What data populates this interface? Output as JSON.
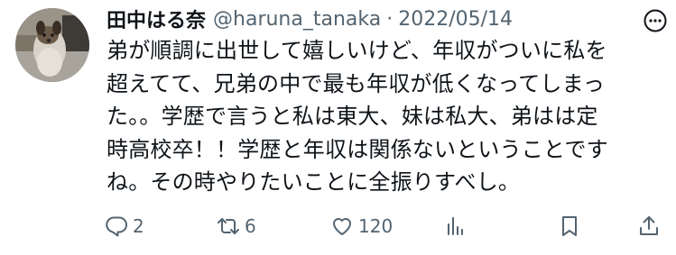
{
  "tweet": {
    "display_name": "田中はる奈",
    "handle": "@haruna_tanaka",
    "separator": "·",
    "date": "2022/05/14",
    "body_lines": [
      "弟が順調に出世して嬉しいけど、年収がついに私を",
      "超えてて、兄弟の中で最も年収が低くなってしまっ",
      "た。。学歴で言うと私は東大、妹は私大、弟はは定",
      "時高校卒！！学歴と年収は関係ないということです",
      "ね。その時やりたいことに全振りすべし。"
    ]
  },
  "actions": {
    "reply": {
      "icon": "reply-icon",
      "count": "2"
    },
    "retweet": {
      "icon": "retweet-icon",
      "count": "6"
    },
    "like": {
      "icon": "heart-icon",
      "count": "120"
    },
    "views": {
      "icon": "analytics-icon"
    },
    "bookmark": {
      "icon": "bookmark-icon"
    },
    "share": {
      "icon": "share-icon"
    }
  },
  "colors": {
    "text_primary": "#0f1419",
    "text_secondary": "#536471"
  }
}
